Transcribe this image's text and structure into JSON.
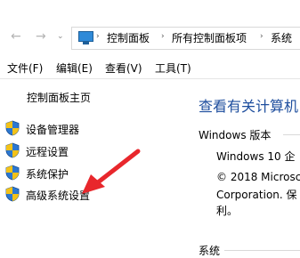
{
  "address": {
    "breadcrumbs": [
      "控制面板",
      "所有控制面板项",
      "系统"
    ]
  },
  "menu": [
    "文件(F)",
    "编辑(E)",
    "查看(V)",
    "工具(T)"
  ],
  "sidebar": {
    "title": "控制面板主页",
    "items": [
      {
        "label": "设备管理器",
        "icon": "shield-icon"
      },
      {
        "label": "远程设置",
        "icon": "shield-icon"
      },
      {
        "label": "系统保护",
        "icon": "shield-icon"
      },
      {
        "label": "高级系统设置",
        "icon": "shield-icon"
      }
    ]
  },
  "main": {
    "title": "查看有关计算机",
    "windows_edition": {
      "heading": "Windows 版本",
      "edition": "Windows 10 企",
      "copyright_1": "© 2018 Microsc",
      "copyright_2": "Corporation. 保",
      "copyright_3": "利。"
    },
    "system_heading": "系统"
  },
  "colors": {
    "accent_title": "#1e4e9e",
    "annotation_arrow": "#e8272c",
    "shield_blue": "#2c78d1",
    "shield_yellow": "#f3c218"
  }
}
